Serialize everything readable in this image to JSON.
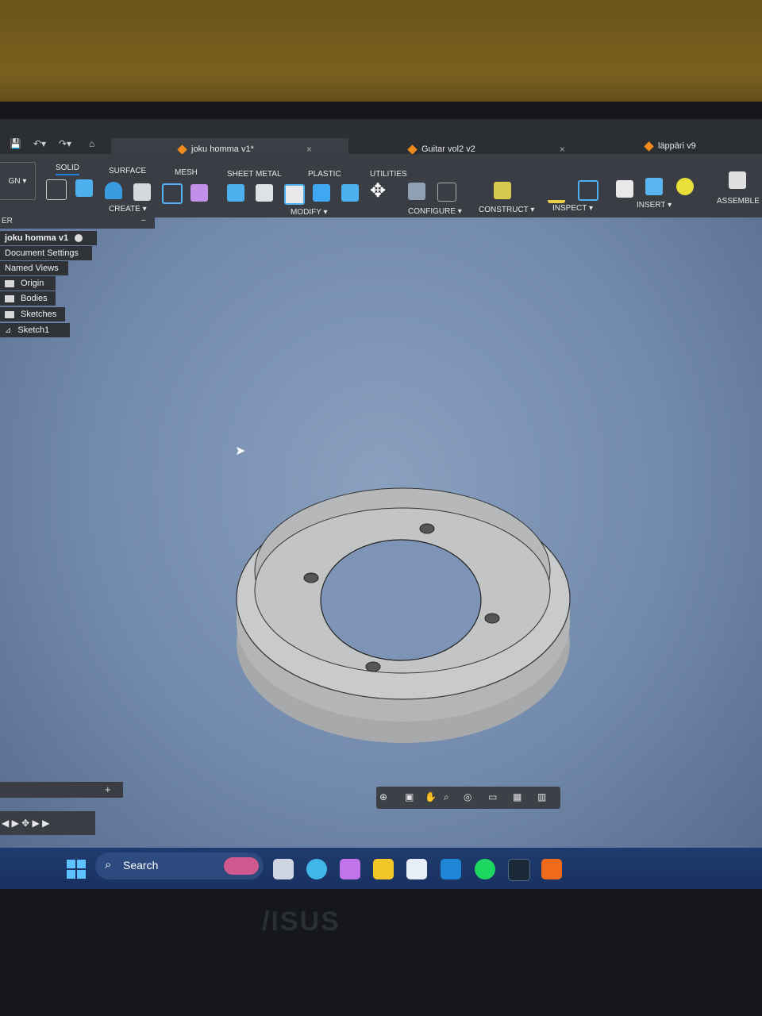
{
  "tabs": [
    {
      "label": "joku homma v1*",
      "close": "×"
    },
    {
      "label": "Guitar vol2 v2",
      "close": "×"
    },
    {
      "label": "läppäri v9"
    }
  ],
  "workspace": {
    "label": "GN"
  },
  "toolbar_tabs": [
    "SOLID",
    "SURFACE",
    "MESH",
    "SHEET METAL",
    "PLASTIC",
    "UTILITIES"
  ],
  "toolbar_groups": [
    "CREATE",
    "MODIFY",
    "CONFIGURE",
    "CONSTRUCT",
    "INSPECT",
    "INSERT",
    "ASSEMBLE"
  ],
  "browser": {
    "header": "ER",
    "collapse": "–",
    "items": [
      "joku homma v1",
      "Document Settings",
      "Named Views",
      "Origin",
      "Bodies",
      "Sketches",
      "Sketch1"
    ]
  },
  "comments": {
    "add": "+"
  },
  "taskbar": {
    "search": "Search"
  },
  "monitor_brand": "/ISUS",
  "colors": {
    "accent": "#1f7ee0",
    "viewport": "#7a90b2",
    "part": "#b9bbbd"
  }
}
